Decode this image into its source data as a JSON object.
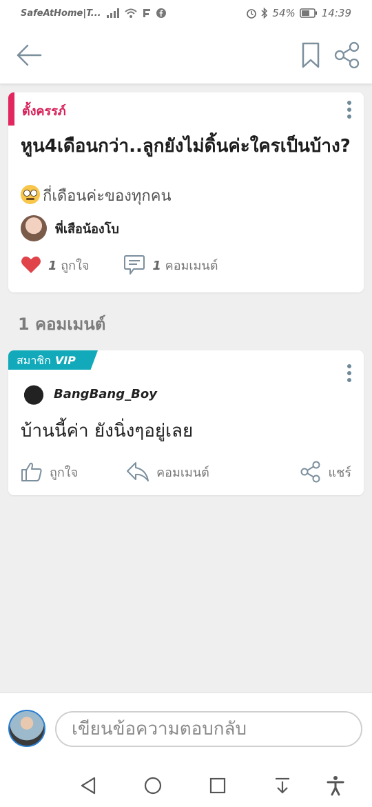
{
  "status_bar": {
    "carrier": "SafeAtHome|T...",
    "battery": "54%",
    "time": "14:39"
  },
  "post": {
    "tag": "ตั้งครรภ์",
    "title": "หูน4เดือนกว่า..ลูกยังไม่ดิ้นค่ะใครเป็นบ้าง?",
    "body": "กี่เดือนค่ะของทุกคน",
    "author": "พี่เสือน้องโบ",
    "likes_count": "1",
    "likes_label": "ถูกใจ",
    "comments_count": "1",
    "comments_label": "คอมเมนต์"
  },
  "comments_heading": "1 คอมเมนต์",
  "comment": {
    "badge": "สมาชิก",
    "badge_vip": "VIP",
    "author": "BangBang_Boy",
    "text": "บ้านนี้ค่า ยังนิ่งๆอยู่เลย",
    "like_label": "ถูกใจ",
    "reply_label": "คอมเมนต์",
    "share_label": "แชร์"
  },
  "reply_bar": {
    "placeholder": "เขียนข้อความตอบกลับ"
  },
  "colors": {
    "accent_pink": "#d61f58",
    "vip_teal": "#12aabb",
    "heart_red": "#e0434a"
  }
}
